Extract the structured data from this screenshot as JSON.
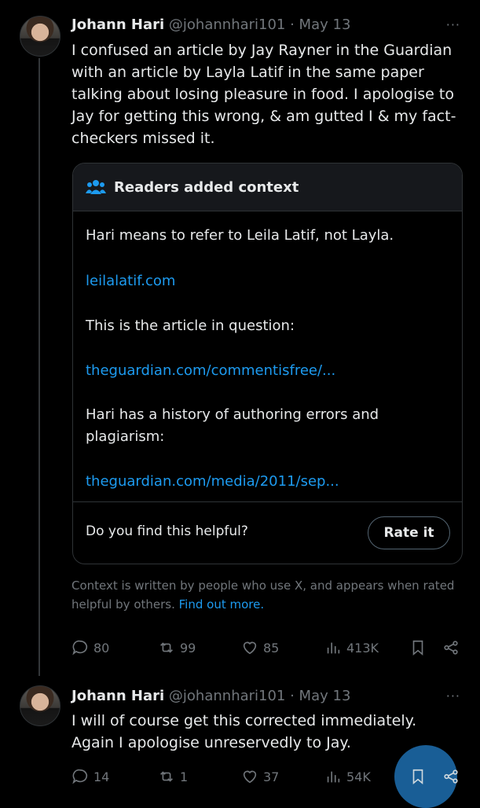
{
  "tweets": [
    {
      "name": "Johann Hari",
      "handle_time": "@johannhari101 · May 13",
      "text": "I confused an article by Jay Rayner in the Guardian with an article by Layla Latif in the same paper talking about losing pleasure in food. I apologise to Jay for getting this wrong, & am gutted I & my fact-checkers missed it.",
      "replies": "80",
      "reposts": "99",
      "likes": "85",
      "views": "413K"
    },
    {
      "name": "Johann Hari",
      "handle_time": "@johannhari101 · May 13",
      "text": "I will of course get this corrected immediately. Again I apologise unreservedly to Jay.",
      "replies": "14",
      "reposts": "1",
      "likes": "37",
      "views": "54K"
    }
  ],
  "note": {
    "title": "Readers added context",
    "p1": "Hari means to refer to Leila Latif, not Layla.",
    "link1": "leilalatif.com",
    "p2": "This is the article in question:",
    "link2": "theguardian.com/commentisfree/...",
    "p3": "Hari has a history of authoring errors and plagiarism:",
    "link3": "theguardian.com/media/2011/sep...",
    "question": "Do you find this helpful?",
    "rate_label": "Rate it"
  },
  "disclaimer": {
    "text": "Context is written by people who use X, and appears when rated helpful by others.",
    "link": "Find out more."
  },
  "more_label": "···",
  "colors": {
    "accent": "#1d9bf0",
    "muted": "#71767b",
    "border": "#2f3336"
  }
}
